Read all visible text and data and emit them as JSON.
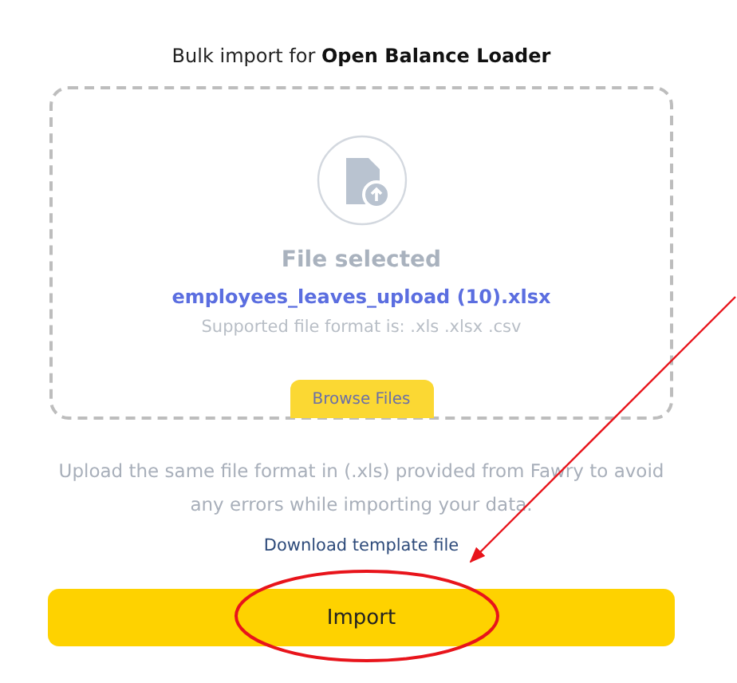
{
  "heading": "Bulk import for **Open Balance Loader**",
  "dropzone": {
    "status": "File selected",
    "file_name": "employees_leaves_upload (10).xlsx",
    "formats": "Supported file format is: .xls .xlsx .csv",
    "browse_button": "Browse Files"
  },
  "note": "Upload the same file format in (.xls) provided from Fawry to avoid any errors while importing your data.",
  "template_link": "Download template file",
  "import_button": "Import"
}
